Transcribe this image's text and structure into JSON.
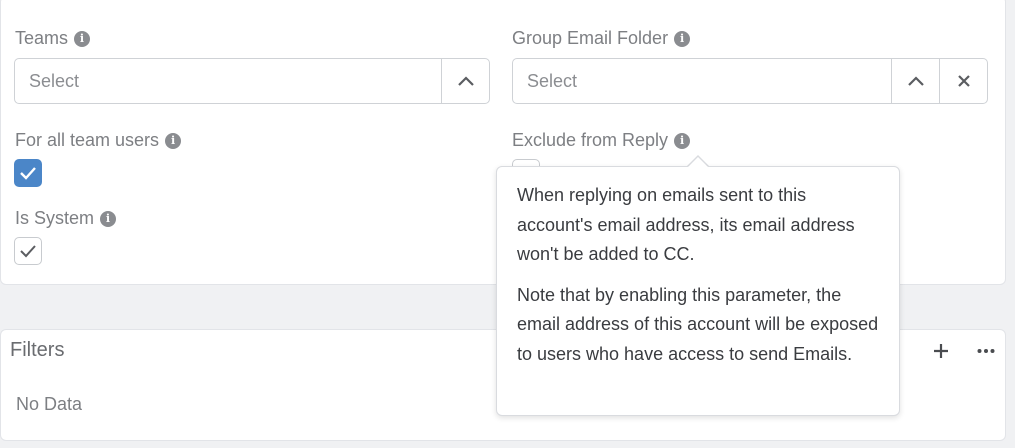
{
  "teams": {
    "label": "Teams",
    "placeholder": "Select"
  },
  "group_email_folder": {
    "label": "Group Email Folder",
    "placeholder": "Select"
  },
  "for_all_team_users": {
    "label": "For all team users",
    "checked": true
  },
  "exclude_from_reply": {
    "label": "Exclude from Reply",
    "checked": false
  },
  "is_system": {
    "label": "Is System",
    "checked": true
  },
  "tooltip": {
    "paragraph1": "When replying on emails sent to this account's email address, its email address won't be added to CC.",
    "paragraph2": "Note that by enabling this parameter, the email address of this account will be exposed to users who have access to send Emails."
  },
  "filters": {
    "title": "Filters",
    "empty_text": "No Data"
  },
  "icons": {
    "info": "info-icon",
    "chevron_up": "chevron-up-icon",
    "close": "close-icon",
    "check": "check-icon",
    "plus": "plus-icon",
    "more": "more-horizontal-icon"
  },
  "colors": {
    "accent": "#4b86c8",
    "label": "#7d7f83"
  }
}
